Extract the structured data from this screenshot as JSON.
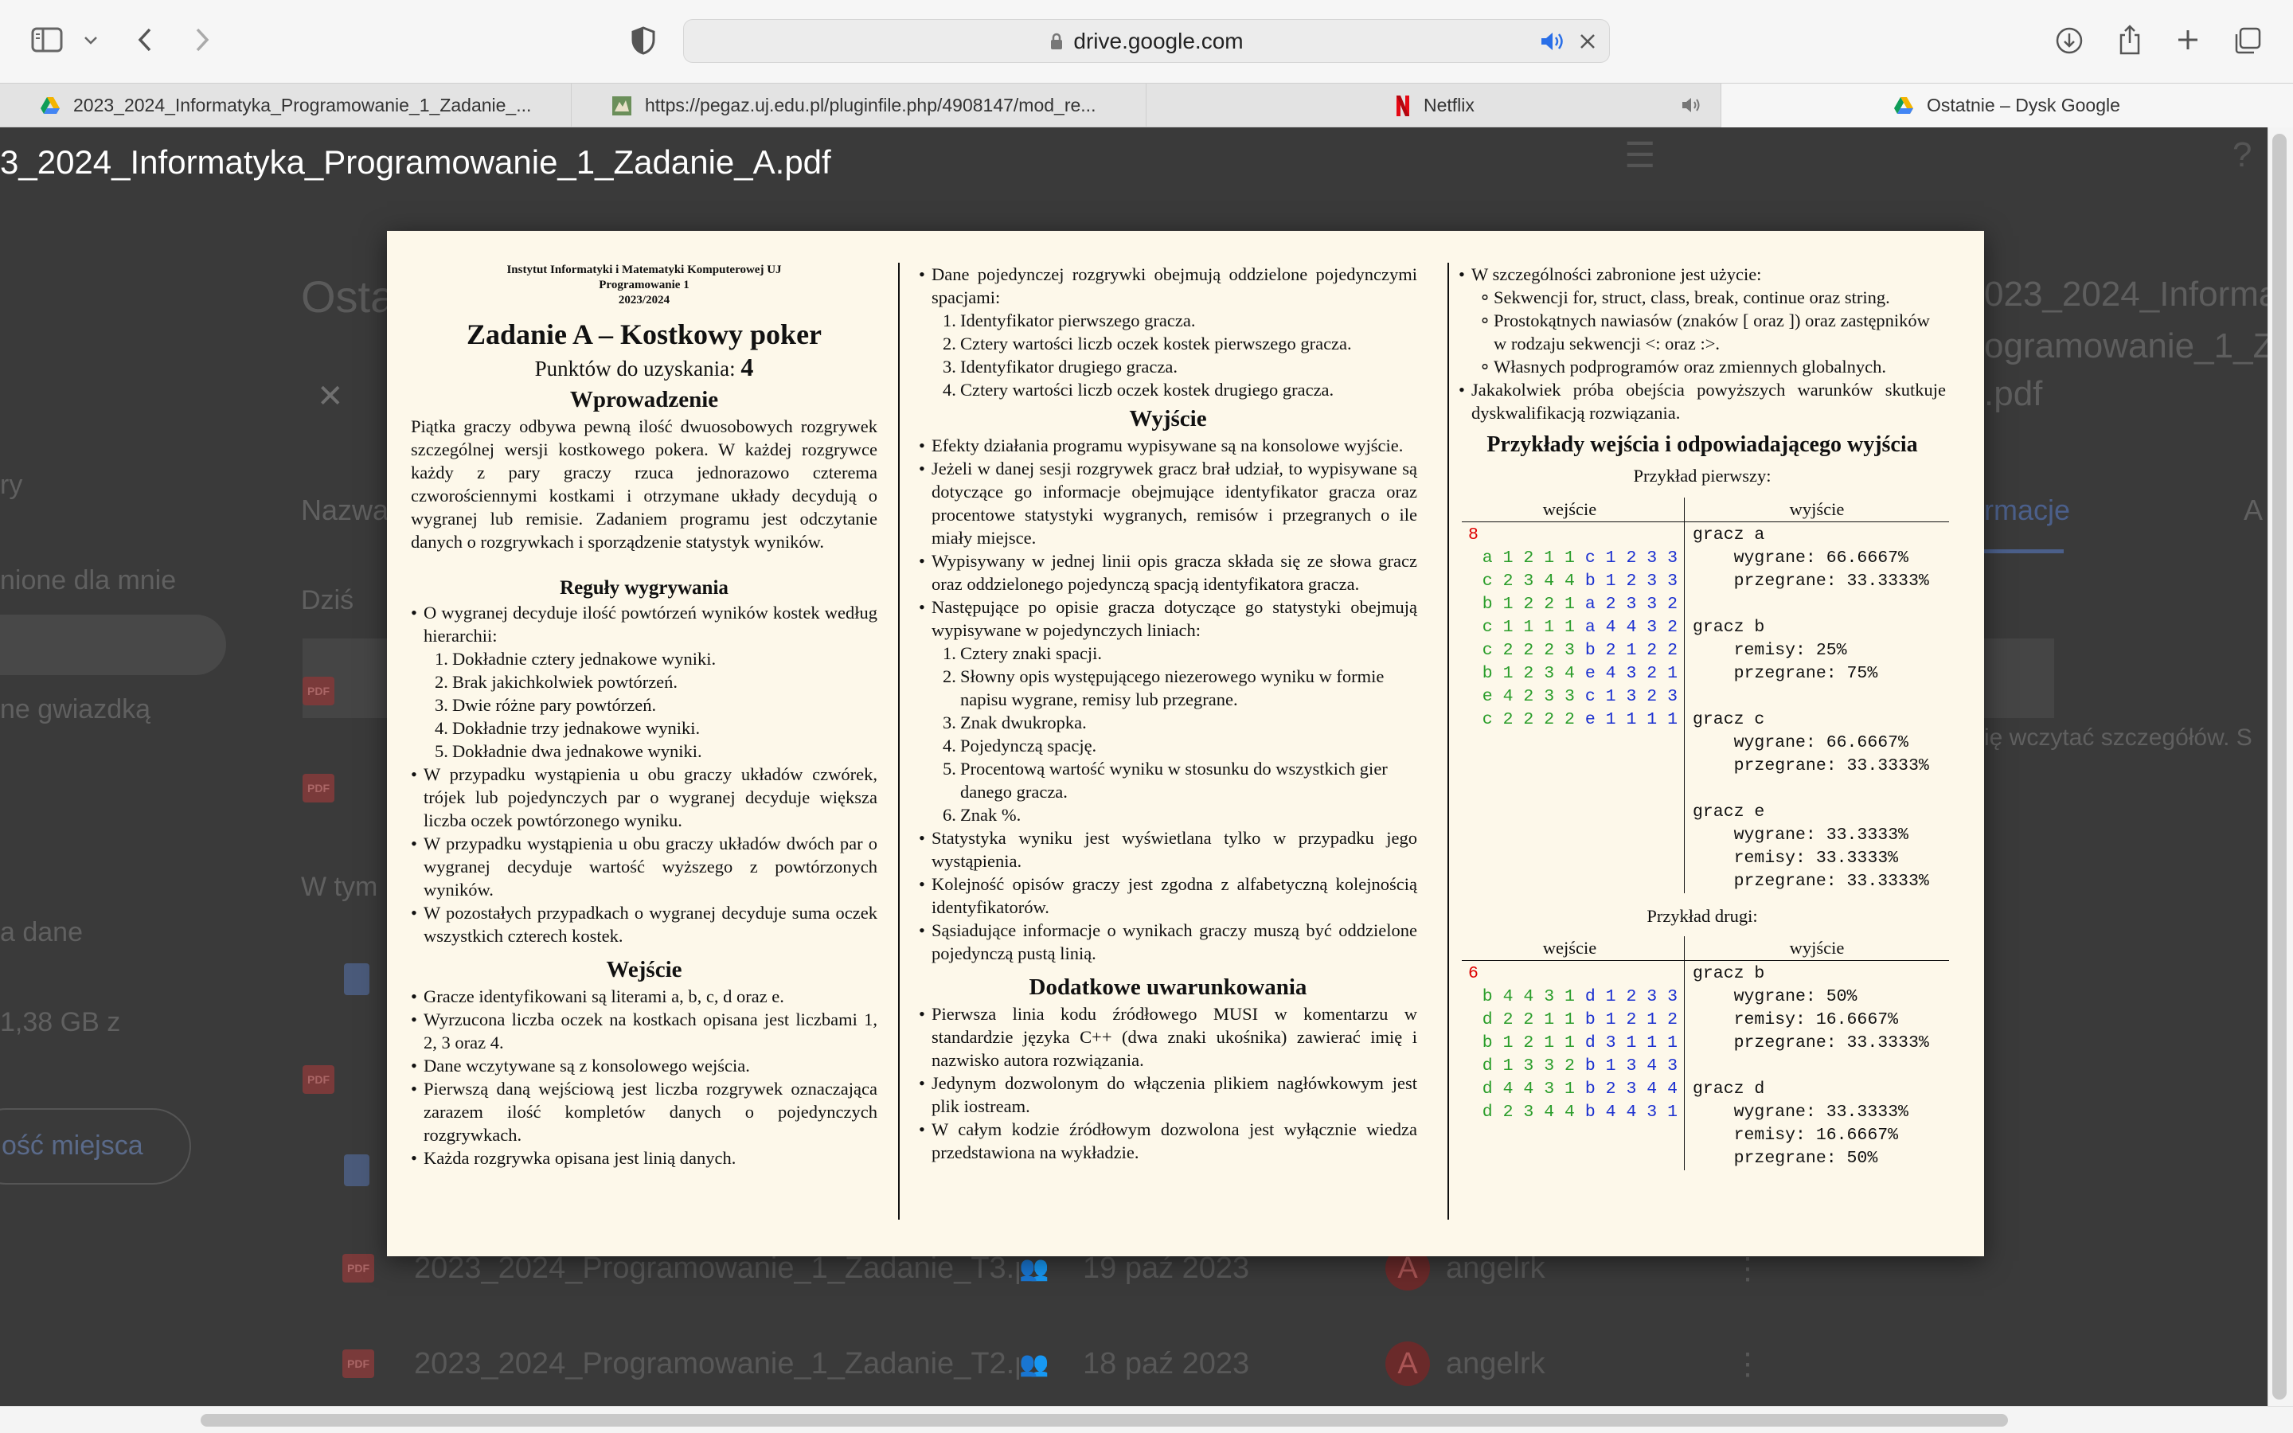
{
  "browser": {
    "address": "drive.google.com",
    "tabs": [
      {
        "label": "2023_2024_Informatyka_Programowanie_1_Zadanie_...",
        "icon": "google-drive-icon",
        "active": false
      },
      {
        "label": "https://pegaz.uj.edu.pl/pluginfile.php/4908147/mod_re...",
        "icon": "site-favicon-icon",
        "active": false
      },
      {
        "label": "Netflix",
        "icon": "netflix-icon",
        "active": false
      },
      {
        "label": "Ostatnie – Dysk Google",
        "icon": "google-drive-icon",
        "active": true
      }
    ]
  },
  "drive_bg": {
    "heading": "Osta",
    "name_col": "Nazwa",
    "today": "Dziś",
    "in_this": "W tym",
    "info_tab": "rmacje",
    "a_tab": "A",
    "side_1": "ry",
    "side_2": "nione dla mnie",
    "side_3": "ne gwiazdką",
    "side_4": "a dane",
    "side_5": "1,38 GB z",
    "storage_btn": "ość miejsca",
    "right_title_1": "023_2024_Informat",
    "right_title_2": "ogramowanie_1_Zad",
    "right_title_3": ".pdf",
    "right_msg": "ię wczytać szczegółów. S",
    "file_rows": [
      {
        "name": "2023_2024_Programowanie_1_Zadanie_T3.p...",
        "date": "19 paź 2023",
        "owner": "angelrk",
        "avatar": "A"
      },
      {
        "name": "2023_2024_Programowanie_1_Zadanie_T2.p...",
        "date": "18 paź 2023",
        "owner": "angelrk",
        "avatar": "A"
      }
    ]
  },
  "viewer": {
    "title": "3_2024_Informatyka_Programowanie_1_Zadanie_A.pdf"
  },
  "doc": {
    "inst_1": "Instytut Informatyki i Matematyki Komputerowej UJ",
    "inst_2": "Programowanie 1",
    "inst_3": "2023/2024",
    "title": "Zadanie A – Kostkowy poker",
    "points_label": "Punktów do uzyskania:",
    "points": "4",
    "intro_h": "Wprowadzenie",
    "intro_p": "Piątka graczy odbywa pewną ilość dwuosobowych rozgrywek szczególnej wersji kostkowego pokera. W każdej rozgrywce każdy z pary graczy rzuca jednorazowo czterema czworościennymi kostkami i otrzymane układy decydują o wygranej lub remisie. Zadaniem programu jest odczytanie danych o rozgrywkach i sporządzenie statystyk wyników.",
    "rules_h": "Reguły wygrywania",
    "rule_1": "O wygranej decyduje ilość powtórzeń wyników kostek według hierarchii:",
    "hier": [
      "Dokładnie cztery jednakowe wyniki.",
      "Brak jakichkolwiek powtórzeń.",
      "Dwie różne pary powtórzeń.",
      "Dokładnie trzy jednakowe wyniki.",
      "Dokładnie dwa jednakowe wyniki."
    ],
    "rule_2": "W przypadku wystąpienia u obu graczy układów czwórek, trójek lub pojedynczych par o wygranej decyduje większa liczba oczek powtórzonego wyniku.",
    "rule_3": "W przypadku wystąpienia u obu graczy układów dwóch par o wygranej decyduje wartość wyższego z powtórzonych wyników.",
    "rule_4": "W pozostałych przypadkach o wygranej decyduje suma oczek wszystkich czterech kostek.",
    "input_h": "Wejście",
    "in_1": "Gracze identyfikowani są literami a, b, c, d oraz e.",
    "in_2": "Wyrzucona liczba oczek na kostkach opisana jest liczbami 1, 2, 3 oraz 4.",
    "in_3": "Dane wczytywane są z konsolowego wejścia.",
    "in_4": "Pierwszą daną wejściową jest liczba rozgrywek oznaczająca zarazem ilość kompletów danych o pojedynczych rozgrywkach.",
    "in_5": "Każda rozgrywka opisana jest linią danych.",
    "c2_in_6": "Dane pojedynczej rozgrywki obejmują oddzielone pojedynczymi spacjami:",
    "game_data": [
      "Identyfikator pierwszego gracza.",
      "Cztery wartości liczb oczek kostek pierwszego gracza.",
      "Identyfikator drugiego gracza.",
      "Cztery wartości liczb oczek kostek drugiego gracza."
    ],
    "output_h": "Wyjście",
    "out_1": "Efekty działania programu wypisywane są na konsolowe wyjście.",
    "out_2": "Jeżeli w danej sesji rozgrywek gracz brał udział, to wypisywane są dotyczące go informacje obejmujące identyfikator gracza oraz procentowe statystyki wygranych, remisów i przegranych o ile miały miejsce.",
    "out_3": "Wypisywany w jednej linii opis gracza składa się ze słowa gracz oraz oddzielonego pojedynczą spacją identyfikatora gracza.",
    "out_4": "Następujące po opisie gracza dotyczące go statystyki obejmują wypisywane w pojedynczych liniach:",
    "stat_1": "Cztery znaki spacji.",
    "stat_2": "Słowny opis występującego niezerowego wyniku w formie napisu wygrane, remisy lub przegrane.",
    "stat_3": "Znak dwukropka.",
    "stat_4": "Pojedynczą spację.",
    "stat_5": "Procentową wartość wyniku w stosunku do wszystkich gier danego gracza.",
    "stat_6": "Znak %.",
    "out_5": "Statystyka wyniku jest wyświetlana tylko w przypadku jego wystąpienia.",
    "out_6": "Kolejność opisów graczy jest zgodna z alfabetyczną kolejnością identyfikatorów.",
    "out_7": "Sąsiadujące informacje o wynikach graczy muszą być oddzielone pojedynczą pustą linią.",
    "add_h": "Dodatkowe uwarunkowania",
    "add_1": "Pierwsza linia kodu źródłowego MUSI w komentarzu w standardzie języka C++ (dwa znaki ukośnika) zawierać imię i nazwisko autora rozwiązania.",
    "add_2": "Jedynym dozwolonym do włączenia plikiem nagłówkowym jest plik iostream.",
    "add_3": "W całym kodzie źródłowym dozwolona jest wyłącznie wiedza przedstawiona na wykładzie.",
    "c3_1": "W szczególności zabronione jest użycie:",
    "forbid_1": "Sekwencji for, struct, class, break, continue oraz string.",
    "forbid_2": "Prostokątnych nawiasów (znaków [ oraz ]) oraz zastępników w rodzaju sekwencji <: oraz :>.",
    "forbid_3": "Własnych podprogramów oraz zmiennych globalnych.",
    "c3_2": "Jakakolwiek próba obejścia powyższych warunków skutkuje dyskwalifikacją rozwiązania.",
    "examples_h": "Przykłady wejścia i odpowiadającego wyjścia",
    "ex1_label": "Przykład pierwszy:",
    "ex2_label": "Przykład drugi:",
    "col_in": "wejście",
    "col_out": "wyjście",
    "ex1_count": "8",
    "ex1_lines": [
      "a 1 2 1 1 c 1 2 3 3",
      "c 2 3 4 4 b 1 2 3 3",
      "b 1 2 2 1 a 2 3 3 2",
      "c 1 1 1 1 a 4 4 3 2",
      "c 2 2 2 3 b 2 1 2 2",
      "b 1 2 3 4 e 4 3 2 1",
      "e 4 2 3 3 c 1 3 2 3",
      "c 2 2 2 2 e 1 1 1 1"
    ],
    "ex1_out": "gracz a\n    wygrane: 66.6667%\n    przegrane: 33.3333%\n\ngracz b\n    remisy: 25%\n    przegrane: 75%\n\ngracz c\n    wygrane: 66.6667%\n    przegrane: 33.3333%\n\ngracz e\n    wygrane: 33.3333%\n    remisy: 33.3333%\n    przegrane: 33.3333%",
    "ex2_count": "6",
    "ex2_lines": [
      "b 4 4 3 1 d 1 2 3 3",
      "d 2 2 1 1 b 1 2 1 2",
      "b 1 2 1 1 d 3 1 1 1",
      "d 1 3 3 2 b 1 3 4 3",
      "d 4 4 3 1 b 2 3 4 4",
      "d 2 3 4 4 b 4 4 3 1"
    ],
    "ex2_out": "gracz b\n    wygrane: 50%\n    remisy: 16.6667%\n    przegrane: 33.3333%\n\ngracz d\n    wygrane: 33.3333%\n    remisy: 16.6667%\n    przegrane: 50%"
  }
}
